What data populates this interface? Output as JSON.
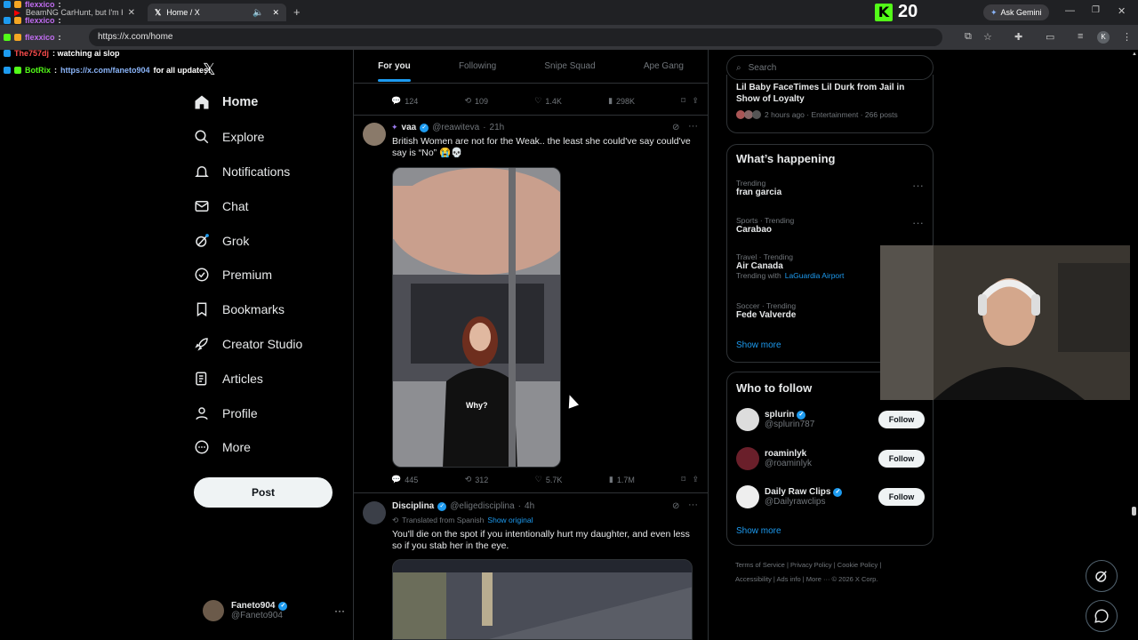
{
  "browser": {
    "tabs": [
      {
        "label": "BeamNG CarHunt, but I'm Hidi"
      },
      {
        "label": "Home / X"
      }
    ],
    "url": "https://x.com/home",
    "kick_count": "20",
    "gemini_label": "Ask Gemini",
    "profile_initial": "K"
  },
  "chat": [
    {
      "user": "flexxico",
      "msg": ":",
      "color": "#c06cf0"
    },
    {
      "user": "flexxico",
      "msg": ":",
      "color": "#c06cf0"
    },
    {
      "user": "flexxico",
      "msg": ":",
      "color": "#c06cf0"
    },
    {
      "user": "The757dj",
      "msg": ": watching ai slop",
      "color": "#ff4d4d"
    },
    {
      "user": "BotRix",
      "msg": ": ",
      "link": "https://x.com/faneto904",
      "tail": " for all updates!",
      "color": "#53fc18"
    }
  ],
  "nav": {
    "items": [
      {
        "label": "Home",
        "icon": "home-icon"
      },
      {
        "label": "Explore",
        "icon": "search-icon"
      },
      {
        "label": "Notifications",
        "icon": "bell-icon"
      },
      {
        "label": "Chat",
        "icon": "mail-icon"
      },
      {
        "label": "Grok",
        "icon": "grok-icon"
      },
      {
        "label": "Premium",
        "icon": "premium-icon"
      },
      {
        "label": "Bookmarks",
        "icon": "bookmark-icon"
      },
      {
        "label": "Creator Studio",
        "icon": "rocket-icon"
      },
      {
        "label": "Articles",
        "icon": "article-icon"
      },
      {
        "label": "Profile",
        "icon": "person-icon"
      },
      {
        "label": "More",
        "icon": "more-icon"
      }
    ],
    "post_label": "Post",
    "account": {
      "name": "Faneto904",
      "handle": "@Faneto904"
    }
  },
  "feed": {
    "tabs": [
      "For you",
      "Following",
      "Snipe Squad",
      "Ape Gang"
    ],
    "prev_actions": {
      "replies": "124",
      "reposts": "109",
      "likes": "1.4K",
      "views": "298K"
    },
    "tweets": [
      {
        "name": "vaa",
        "handle": "@reawiteva",
        "time": "21h",
        "text": "British Women are not for the Weak.. the least she could've say could've say is “No” 😭💀",
        "media_caption": "Why?",
        "actions": {
          "replies": "445",
          "reposts": "312",
          "likes": "5.7K",
          "views": "1.7M"
        }
      },
      {
        "name": "Disciplina",
        "handle": "@eligedisciplina",
        "time": "4h",
        "translated": "Translated from Spanish",
        "show_original": "Show original",
        "text": "You'll die on the spot if you intentionally hurt my daughter, and even less so if you stab her in the eye."
      }
    ]
  },
  "sidebar": {
    "search_placeholder": "Search",
    "top_story": {
      "title": "Lil Baby FaceTimes Lil Durk from Jail in Show of Loyalty",
      "meta": "2 hours ago · Entertainment · 266 posts"
    },
    "happening_title": "What’s happening",
    "trends": [
      {
        "meta": "Trending",
        "name": "fran garcia"
      },
      {
        "meta": "Sports · Trending",
        "name": "Carabao"
      },
      {
        "meta": "Travel · Trending",
        "name": "Air Canada",
        "with_label": "Trending with",
        "with_link": "LaGuardia Airport"
      },
      {
        "meta": "Soccer · Trending",
        "name": "Fede Valverde"
      }
    ],
    "show_more": "Show more",
    "follow_title": "Who to follow",
    "follow": [
      {
        "name": "splurin",
        "handle": "@splurin787",
        "button": "Follow"
      },
      {
        "name": "roaminlyk",
        "handle": "@roaminlyk",
        "button": "Follow"
      },
      {
        "name": "Daily Raw Clips",
        "handle": "@Dailyrawclips",
        "button": "Follow"
      }
    ],
    "footer": [
      "Terms of Service",
      "Privacy Policy",
      "Cookie Policy",
      "Accessibility",
      "Ads info",
      "More ···",
      "© 2026 X Corp."
    ]
  },
  "colors": {
    "accent": "#1d9bf0",
    "kick": "#53fc18",
    "background": "#000000"
  }
}
